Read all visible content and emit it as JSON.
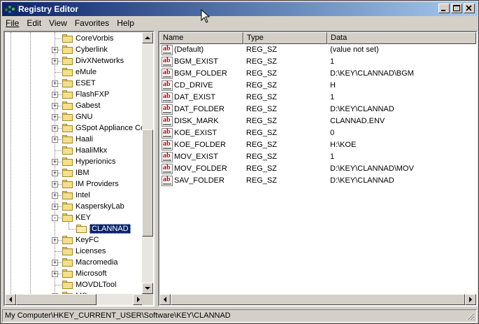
{
  "window": {
    "title": "Registry Editor"
  },
  "caption_buttons": {
    "minimize": "_",
    "maximize": "□",
    "close": "✕"
  },
  "menu": [
    "File",
    "Edit",
    "View",
    "Favorites",
    "Help"
  ],
  "tree": {
    "items": [
      {
        "label": "CoreVorbis",
        "expander": ""
      },
      {
        "label": "Cyberlink",
        "expander": "+"
      },
      {
        "label": "DivXNetworks",
        "expander": "+"
      },
      {
        "label": "eMule",
        "expander": ""
      },
      {
        "label": "ESET",
        "expander": "+"
      },
      {
        "label": "FlashFXP",
        "expander": "+"
      },
      {
        "label": "Gabest",
        "expander": "+"
      },
      {
        "label": "GNU",
        "expander": "+"
      },
      {
        "label": "GSpot Appliance Cor",
        "expander": "+"
      },
      {
        "label": "Haali",
        "expander": "+"
      },
      {
        "label": "HaaliMkx",
        "expander": ""
      },
      {
        "label": "Hyperionics",
        "expander": "+"
      },
      {
        "label": "IBM",
        "expander": "+"
      },
      {
        "label": "IM Providers",
        "expander": "+"
      },
      {
        "label": "Intel",
        "expander": "+"
      },
      {
        "label": "KasperskyLab",
        "expander": "+"
      },
      {
        "label": "KEY",
        "expander": "-"
      },
      {
        "label": "CLANNAD",
        "expander": "",
        "child": true,
        "selected": true
      },
      {
        "label": "KeyFC",
        "expander": "+"
      },
      {
        "label": "Licenses",
        "expander": ""
      },
      {
        "label": "Macromedia",
        "expander": "+"
      },
      {
        "label": "Microsoft",
        "expander": "+"
      },
      {
        "label": "MOVDLTool",
        "expander": ""
      },
      {
        "label": "MS",
        "expander": "+"
      }
    ]
  },
  "list": {
    "columns": [
      "Name",
      "Type",
      "Data"
    ],
    "rows": [
      {
        "name": "(Default)",
        "type": "REG_SZ",
        "data": "(value not set)"
      },
      {
        "name": "BGM_EXIST",
        "type": "REG_SZ",
        "data": "1"
      },
      {
        "name": "BGM_FOLDER",
        "type": "REG_SZ",
        "data": "D:\\KEY\\CLANNAD\\BGM"
      },
      {
        "name": "CD_DRIVE",
        "type": "REG_SZ",
        "data": "H"
      },
      {
        "name": "DAT_EXIST",
        "type": "REG_SZ",
        "data": "1"
      },
      {
        "name": "DAT_FOLDER",
        "type": "REG_SZ",
        "data": "D:\\KEY\\CLANNAD"
      },
      {
        "name": "DISK_MARK",
        "type": "REG_SZ",
        "data": "CLANNAD.ENV"
      },
      {
        "name": "KOE_EXIST",
        "type": "REG_SZ",
        "data": "0"
      },
      {
        "name": "KOE_FOLDER",
        "type": "REG_SZ",
        "data": "H:\\KOE"
      },
      {
        "name": "MOV_EXIST",
        "type": "REG_SZ",
        "data": "1"
      },
      {
        "name": "MOV_FOLDER",
        "type": "REG_SZ",
        "data": "D:\\KEY\\CLANNAD\\MOV"
      },
      {
        "name": "SAV_FOLDER",
        "type": "REG_SZ",
        "data": "D:\\KEY\\CLANNAD"
      }
    ],
    "value_icon": "string-value-icon"
  },
  "statusbar": {
    "path": "My Computer\\HKEY_CURRENT_USER\\Software\\KEY\\CLANNAD"
  },
  "colors": {
    "titlebar_start": "#0a246a",
    "titlebar_end": "#a6caf0",
    "selection": "#0a246a"
  }
}
